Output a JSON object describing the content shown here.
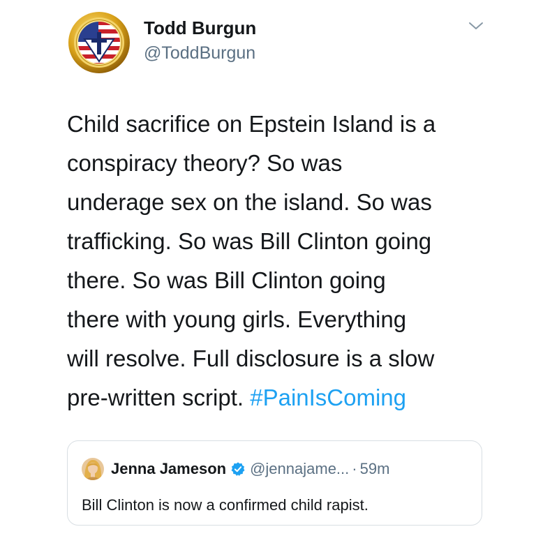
{
  "author": {
    "display_name": "Todd Burgun",
    "handle": "@ToddBurgun",
    "avatar_icon": "flag-cross-emblem-avatar"
  },
  "menu_icon": "chevron-down-icon",
  "tweet": {
    "lines": [
      "Child sacrifice on Epstein Island is a",
      "conspiracy theory? So was",
      "underage sex on the island. So was",
      "trafficking. So was Bill Clinton going",
      "there. So was Bill Clinton going",
      "there with young girls. Everything",
      "will resolve. Full disclosure is a slow",
      "pre-written script. "
    ],
    "hashtag": "#PainIsComing"
  },
  "quoted_tweet": {
    "display_name": "Jenna Jameson",
    "verified_icon": "verified-badge-icon",
    "handle": "@jennajame...",
    "separator": "·",
    "time": "59m",
    "text": "Bill Clinton is now a confirmed child rapist."
  },
  "colors": {
    "text": "#14171a",
    "secondary": "#5b7083",
    "hashtag": "#1da1f2",
    "verified": "#1da1f2",
    "border": "#d8dee3"
  }
}
